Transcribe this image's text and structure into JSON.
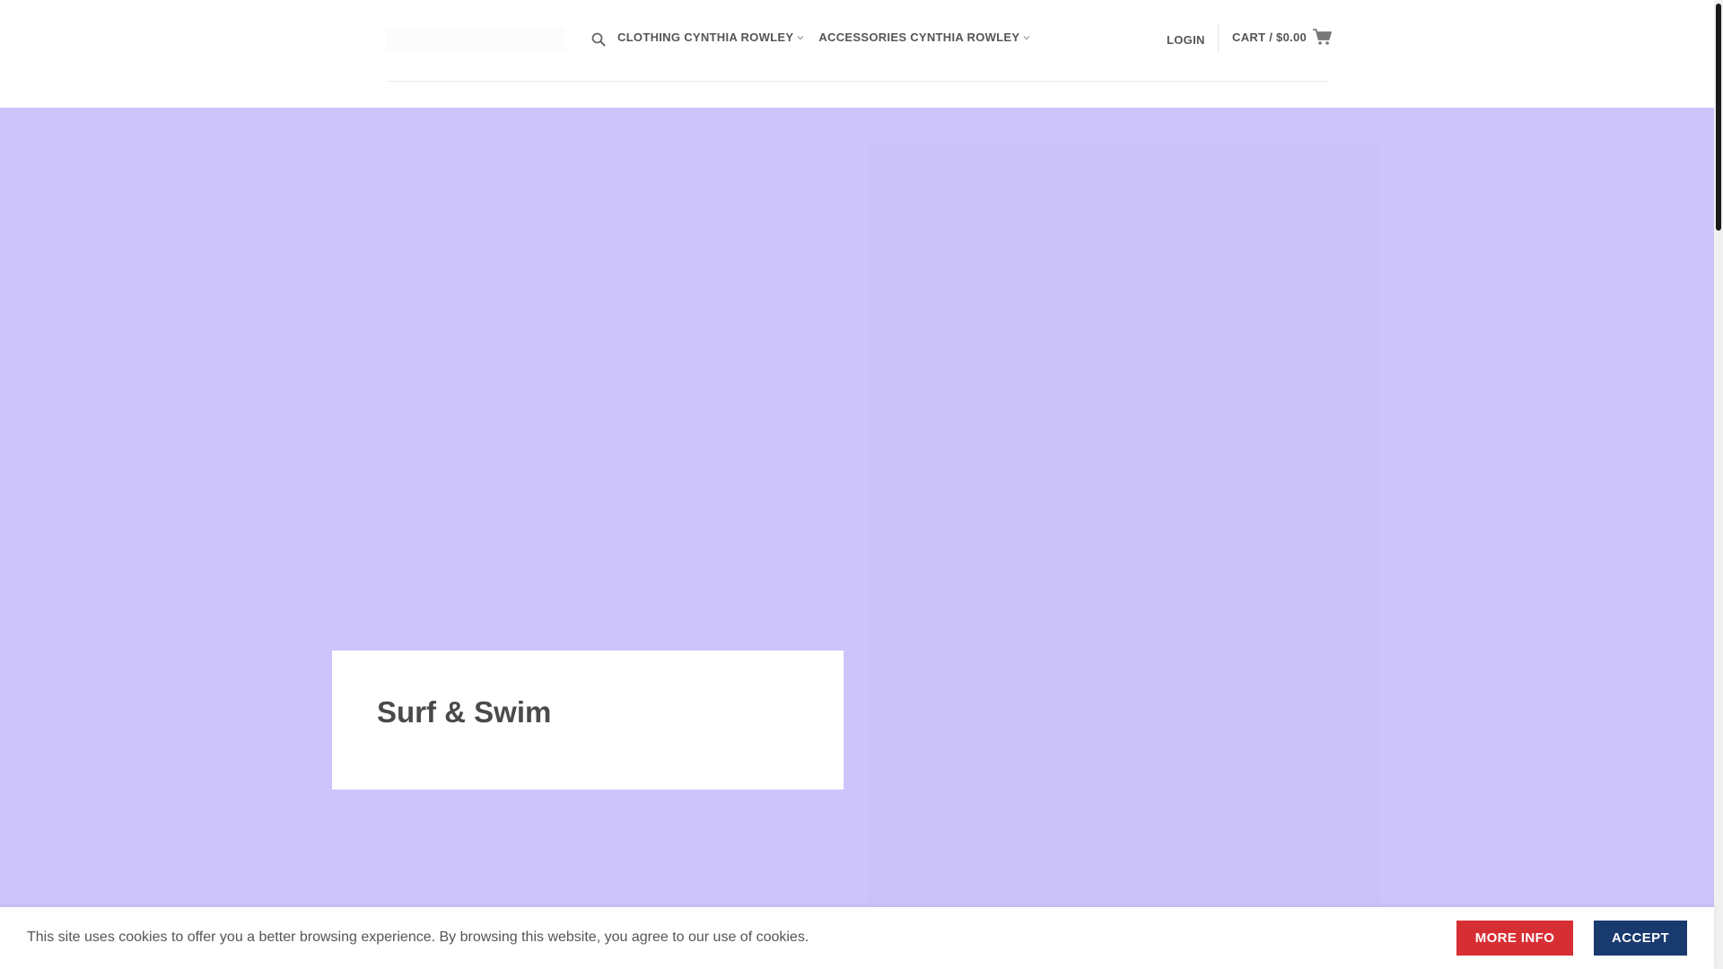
{
  "header": {
    "nav": [
      {
        "label": "CLOTHING CYNTHIA ROWLEY",
        "icon": "chevron-down-icon"
      },
      {
        "label": "ACCESSORIES CYNTHIA ROWLEY",
        "icon": "chevron-down-icon"
      }
    ],
    "login_label": "LOGIN",
    "cart_label": "CART / $0.00",
    "search_icon": "search-icon",
    "cart_icon": "cart-icon"
  },
  "hero": {
    "title": "Surf & Swim",
    "background_color": "#cdc4fb"
  },
  "cookie_banner": {
    "text": "This site uses cookies to offer you a better browsing experience. By browsing this website, you agree to our use of cookies.",
    "more_info_label": "MORE INFO",
    "accept_label": "ACCEPT",
    "more_info_color": "#d72e34",
    "accept_color": "#193a6e"
  }
}
